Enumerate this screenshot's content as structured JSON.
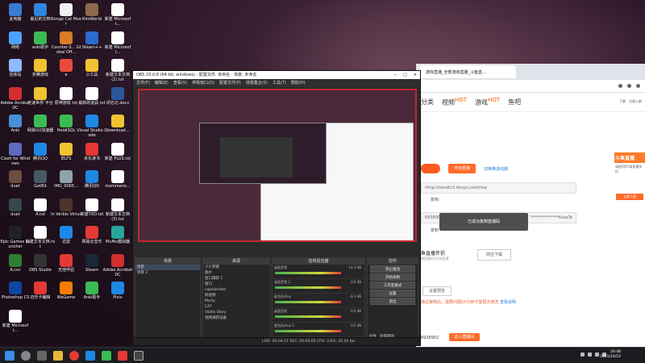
{
  "desktop_icons": [
    {
      "label": "此电脑",
      "color": "#3a7bd5"
    },
    {
      "label": "最近的文档",
      "color": "#2f86e0"
    },
    {
      "label": "Bongo Cat Mver",
      "color": "#f0f0f0"
    },
    {
      "label": "RimWorld",
      "color": "#8b6a4c"
    },
    {
      "label": "新建 Microsoft...",
      "color": "#ffffff"
    },
    {
      "label": "网络",
      "color": "#4ea1ff"
    },
    {
      "label": "anki助手",
      "color": "#3cba54"
    },
    {
      "label": "Counter-S... Global Off...",
      "color": "#d97b26"
    },
    {
      "label": "Steam++",
      "color": "#2a6bd1"
    },
    {
      "label": "新建 Microsoft...",
      "color": "#ffffff"
    },
    {
      "label": "回收站",
      "color": "#8fb9ff"
    },
    {
      "label": "折腾游戏",
      "color": "#f1c232"
    },
    {
      "label": "e",
      "color": "#e94b3c"
    },
    {
      "label": "小工具",
      "color": "#f1c232"
    },
    {
      "label": "新建文本文档(2).txt",
      "color": "#ffffff"
    },
    {
      "label": "Adobe Acrobat DC",
      "color": "#d32f2f"
    },
    {
      "label": "光速世界 平台",
      "color": "#f1c232"
    },
    {
      "label": "原神游戏 txt",
      "color": "#ffffff"
    },
    {
      "label": "最新的道具 txt",
      "color": "#ffffff"
    },
    {
      "label": "评估记.docx",
      "color": "#2b579a"
    },
    {
      "label": "Anki",
      "color": "#4a90d9"
    },
    {
      "label": "网易UU加速器",
      "color": "#3cba54"
    },
    {
      "label": "HeidiSQL",
      "color": "#3cba54"
    },
    {
      "label": "Visual Studio Code",
      "color": "#1e88e5"
    },
    {
      "label": "download...",
      "color": "#f1c232"
    },
    {
      "label": "Clash for Windows",
      "color": "#5c6bc0"
    },
    {
      "label": "腾讯QQ",
      "color": "#1e88e5"
    },
    {
      "label": "IELTS",
      "color": "#f1c232"
    },
    {
      "label": "京东读书",
      "color": "#e53935"
    },
    {
      "label": "新建 PLUS.txt",
      "color": "#ffffff"
    },
    {
      "label": "duet",
      "color": "#6d4c41"
    },
    {
      "label": "GetBit",
      "color": "#455a64"
    },
    {
      "label": "IMG_0065...",
      "color": "#90a4ae"
    },
    {
      "label": "腾讯QQ",
      "color": "#1e88e5"
    },
    {
      "label": "mainmeno...",
      "color": "#ffffff"
    },
    {
      "label": "duet",
      "color": "#37474f"
    },
    {
      "label": "A.txt",
      "color": "#ffffff"
    },
    {
      "label": "In Verbis Virtus",
      "color": "#4e342e"
    },
    {
      "label": "新建TXD.txt",
      "color": "#ffffff"
    },
    {
      "label": "新建文本文档(3).txt",
      "color": "#ffffff"
    },
    {
      "label": "Epic Games Launcher",
      "color": "#222222"
    },
    {
      "label": "新建文本文档.txt",
      "color": "#ffffff"
    },
    {
      "label": "迅雷",
      "color": "#1e88e5"
    },
    {
      "label": "网易云音乐",
      "color": "#e53935"
    },
    {
      "label": "MuMu模拟器",
      "color": "#26a69a"
    },
    {
      "label": "A.csv",
      "color": "#2e7d32"
    },
    {
      "label": "OBS Studio",
      "color": "#333333"
    },
    {
      "label": "无他伴侣",
      "color": "#e53935"
    },
    {
      "label": "Steam",
      "color": "#1b2838"
    },
    {
      "label": "Adobe Acrobat DC",
      "color": "#d32f2f"
    },
    {
      "label": "Photoshop CS",
      "color": "#0d47a1"
    },
    {
      "label": "迈乐卡编辑",
      "color": "#e53935"
    },
    {
      "label": "WeGame",
      "color": "#f57c00"
    },
    {
      "label": "Anki助手",
      "color": "#3cba54"
    },
    {
      "label": "Pixiv",
      "color": "#1e88e5"
    },
    {
      "label": "新建 Microsoft...",
      "color": "#ffffff"
    }
  ],
  "browser": {
    "tab_title": "游戏直播_全部游戏直播_斗鱼直...",
    "nav": [
      "分类",
      "视频",
      "游戏",
      "鱼吧"
    ],
    "hot": "HOT",
    "right_items": [
      "下载",
      "注册入群"
    ],
    "start_btn": "开始直播",
    "switch_link": "切换推流线路",
    "rtmp": "rtmp://sendtc3.douyu.com/live",
    "copy1": "复制",
    "key_prefix": "6938902",
    "key_suffix": "**************6vasTo",
    "copy2": "复制",
    "assistant_title": "鱼直播伴侣",
    "assistant_sub": "播直播你1次就直播",
    "download": "前往下载",
    "preview_btn": "设置预告",
    "notice": "通过审核后，需要间隔10分钟才能再次修改",
    "notice_link": "查看说明",
    "room": "6938902",
    "enter_btn": "进入直播间",
    "toast": "已成功复制直播码",
    "banner_title": "斗鱼直播",
    "banner_sub": "请使用PC端直播伴侣",
    "banner_btn": "立即下载"
  },
  "obs": {
    "title": "OBS 25.0.8 (64-bit, windows) - 配置文件: 未命名 - 场景: 未命名",
    "menu": [
      "文件(F)",
      "编辑(E)",
      "查看(V)",
      "停靠窗口(D)",
      "配置文件(P)",
      "场景集合(S)",
      "工具(T)",
      "帮助(H)"
    ],
    "scenes_header": "场景",
    "scenes": [
      "场景",
      "场景 2"
    ],
    "sources_header": "来源",
    "sources": [
      "小小梦魇",
      "图片",
      "窗口捕获 1",
      "窗口",
      "capslimited",
      "新视频",
      "Morty",
      "CAT",
      "Valdis Story",
      "视频捕获设备"
    ],
    "mixer_header": "音频混音器",
    "mixer": [
      {
        "name": "桌面音频",
        "db": "-14.3 dB"
      },
      {
        "name": "桌面音频 2",
        "db": "0.0 dB"
      },
      {
        "name": "麦克风/Aux",
        "db": "-6.3 dB"
      },
      {
        "name": "桌面音频",
        "db": "0.0 dB"
      },
      {
        "name": "麦克风/Aux 2",
        "db": "0.0 dB"
      }
    ],
    "controls_header": "控件",
    "controls": [
      "停止推流",
      "开始录制",
      "工作室模式",
      "设置",
      "退出"
    ],
    "footer_tabs": [
      "控件",
      "场景转场"
    ],
    "status": "LIVE: 00:04:21  REC: 00:00:00  CPU: 3.6%, 30.00 fps"
  },
  "taskbar": {
    "time": "20:48",
    "date": "2021/10/10"
  }
}
